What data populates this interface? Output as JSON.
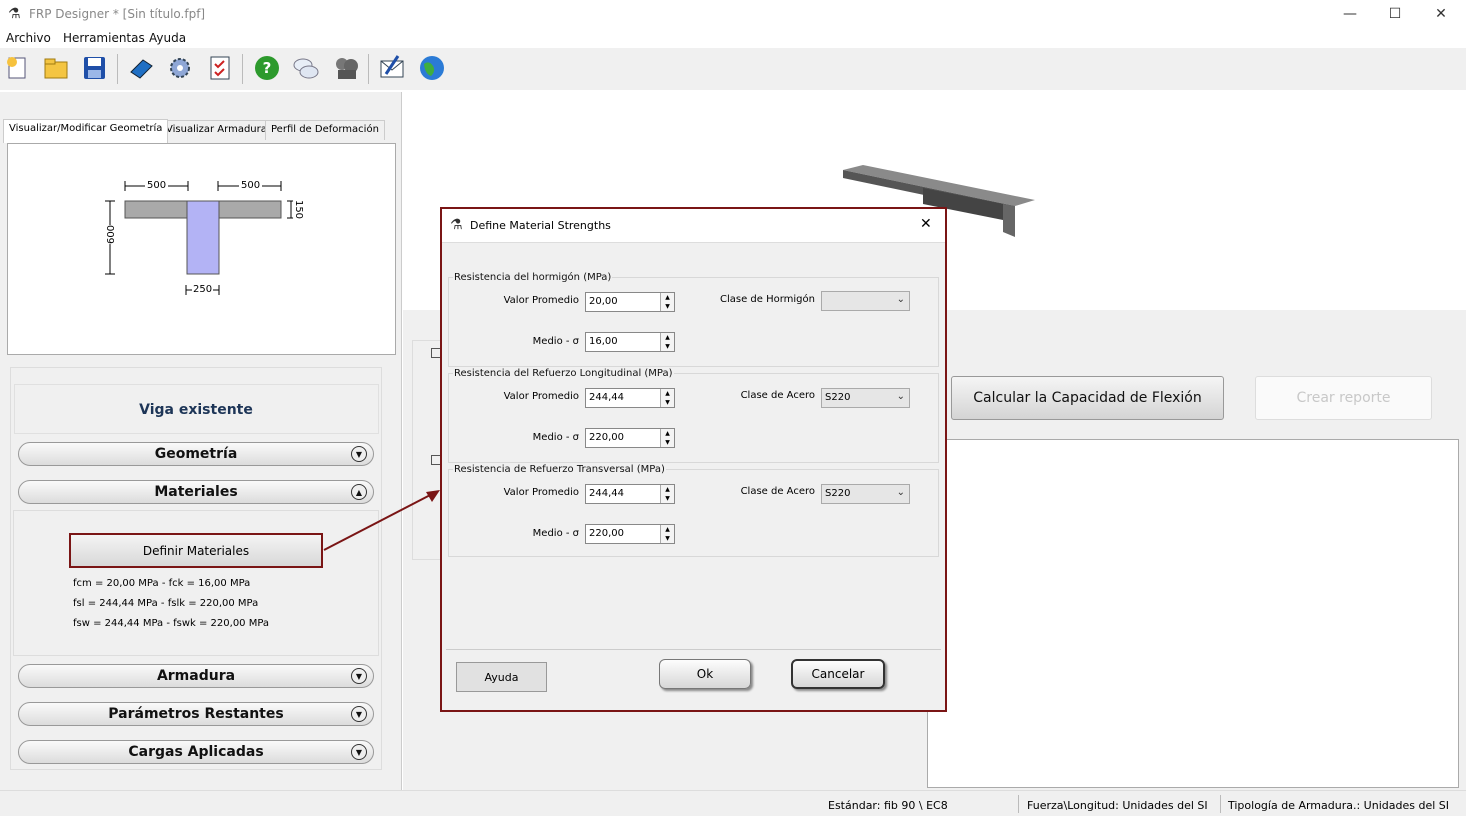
{
  "window": {
    "title": "FRP Designer * [Sin título.fpf]",
    "min": "—",
    "max": "☐",
    "close": "✕"
  },
  "menu": [
    "Archivo",
    "Herramientas",
    "Ayuda"
  ],
  "tabs": [
    "Visualizar/Modificar Geometría",
    "Visualizar Armadura",
    "Perfil de Deformación"
  ],
  "section": {
    "dim_left": "500",
    "dim_right": "500",
    "dim_height": "600",
    "dim_flange": "150",
    "dim_web": "250"
  },
  "panel": {
    "title": "Viga existente",
    "geometria": "Geometría",
    "materiales": "Materiales",
    "definir_btn": "Definir Materiales",
    "line1": "fcm = 20,00 MPa   -   fck = 16,00 MPa",
    "line2": "fsl = 244,44 MPa   -   fslk = 220,00 MPa",
    "line3": "fsw = 244,44 MPa   -   fswk = 220,00 MPa",
    "armadura": "Armadura",
    "parametros": "Parámetros Restantes",
    "cargas": "Cargas Aplicadas"
  },
  "main": {
    "calc_btn": "Calcular la Capacidad de Flexión",
    "report_btn": "Crear reporte"
  },
  "status": {
    "estandar": "Estándar: fib 90 \\ EC8",
    "unidades": "Fuerza\\Longitud: Unidades del SI",
    "tipologia": "Tipología de Armadura.: Unidades del SI"
  },
  "dialog": {
    "title": "Define Material Strengths",
    "g1": {
      "label": "Resistencia del hormigón (MPa)",
      "vp_label": "Valor Promedio",
      "vp": "20,00",
      "m_label": "Medio - σ",
      "m": "16,00",
      "class_label": "Clase de Hormigón",
      "class": ""
    },
    "g2": {
      "label": "Resistencia del Refuerzo Longitudinal (MPa)",
      "vp_label": "Valor Promedio",
      "vp": "244,44",
      "m_label": "Medio - σ",
      "m": "220,00",
      "class_label": "Clase de Acero",
      "class": "S220"
    },
    "g3": {
      "label": "Resistencia de Refuerzo Transversal (MPa)",
      "vp_label": "Valor Promedio",
      "vp": "244,44",
      "m_label": "Medio - σ",
      "m": "220,00",
      "class_label": "Clase de Acero",
      "class": "S220"
    },
    "ayuda": "Ayuda",
    "ok": "Ok",
    "cancel": "Cancelar"
  },
  "colors": {
    "accent": "#7a1515",
    "web": "#b3b3f5",
    "flange": "#a9a9a9"
  }
}
